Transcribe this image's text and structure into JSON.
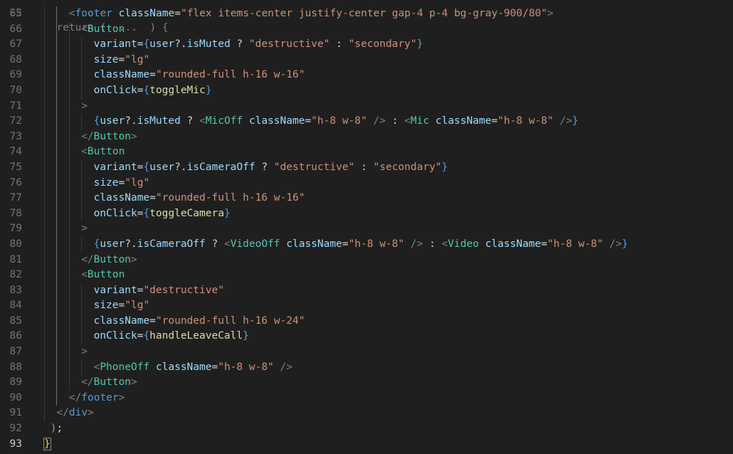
{
  "editor": {
    "top_partial_line": {
      "number": "22",
      "text": "  return (  ...  ) {"
    },
    "current_line": 93,
    "lines": [
      {
        "n": "65",
        "indent": 2,
        "tokens": [
          {
            "c": "t-punc",
            "t": "<"
          },
          {
            "c": "t-html",
            "t": "footer"
          },
          {
            "c": "t-text",
            "t": " "
          },
          {
            "c": "t-attr",
            "t": "className"
          },
          {
            "c": "t-text",
            "t": "="
          },
          {
            "c": "t-str",
            "t": "\"flex items-center justify-center gap-4 p-4 bg-gray-900/80\""
          },
          {
            "c": "t-punc",
            "t": ">"
          }
        ]
      },
      {
        "n": "66",
        "indent": 3,
        "tokens": [
          {
            "c": "t-punc",
            "t": "<"
          },
          {
            "c": "t-tag",
            "t": "Button"
          }
        ]
      },
      {
        "n": "67",
        "indent": 4,
        "tokens": [
          {
            "c": "t-attr",
            "t": "variant"
          },
          {
            "c": "t-text",
            "t": "="
          },
          {
            "c": "t-brace",
            "t": "{"
          },
          {
            "c": "t-attr",
            "t": "user"
          },
          {
            "c": "t-text",
            "t": "?."
          },
          {
            "c": "t-attr",
            "t": "isMuted"
          },
          {
            "c": "t-text",
            "t": " ? "
          },
          {
            "c": "t-str",
            "t": "\"destructive\""
          },
          {
            "c": "t-text",
            "t": " : "
          },
          {
            "c": "t-str",
            "t": "\"secondary\""
          },
          {
            "c": "t-brace",
            "t": "}"
          }
        ]
      },
      {
        "n": "68",
        "indent": 4,
        "tokens": [
          {
            "c": "t-attr",
            "t": "size"
          },
          {
            "c": "t-text",
            "t": "="
          },
          {
            "c": "t-str",
            "t": "\"lg\""
          }
        ]
      },
      {
        "n": "69",
        "indent": 4,
        "tokens": [
          {
            "c": "t-attr",
            "t": "className"
          },
          {
            "c": "t-text",
            "t": "="
          },
          {
            "c": "t-str",
            "t": "\"rounded-full h-16 w-16\""
          }
        ]
      },
      {
        "n": "70",
        "indent": 4,
        "tokens": [
          {
            "c": "t-attr",
            "t": "onClick"
          },
          {
            "c": "t-text",
            "t": "="
          },
          {
            "c": "t-brace",
            "t": "{"
          },
          {
            "c": "t-fn",
            "t": "toggleMic"
          },
          {
            "c": "t-brace",
            "t": "}"
          }
        ]
      },
      {
        "n": "71",
        "indent": 3,
        "tokens": [
          {
            "c": "t-punc",
            "t": ">"
          }
        ]
      },
      {
        "n": "72",
        "indent": 4,
        "tokens": [
          {
            "c": "t-brace",
            "t": "{"
          },
          {
            "c": "t-attr",
            "t": "user"
          },
          {
            "c": "t-text",
            "t": "?."
          },
          {
            "c": "t-attr",
            "t": "isMuted"
          },
          {
            "c": "t-text",
            "t": " ? "
          },
          {
            "c": "t-punc",
            "t": "<"
          },
          {
            "c": "t-tag",
            "t": "MicOff"
          },
          {
            "c": "t-text",
            "t": " "
          },
          {
            "c": "t-attr",
            "t": "className"
          },
          {
            "c": "t-text",
            "t": "="
          },
          {
            "c": "t-str",
            "t": "\"h-8 w-8\""
          },
          {
            "c": "t-text",
            "t": " "
          },
          {
            "c": "t-punc",
            "t": "/>"
          },
          {
            "c": "t-text",
            "t": " : "
          },
          {
            "c": "t-punc",
            "t": "<"
          },
          {
            "c": "t-tag",
            "t": "Mic"
          },
          {
            "c": "t-text",
            "t": " "
          },
          {
            "c": "t-attr",
            "t": "className"
          },
          {
            "c": "t-text",
            "t": "="
          },
          {
            "c": "t-str",
            "t": "\"h-8 w-8\""
          },
          {
            "c": "t-text",
            "t": " "
          },
          {
            "c": "t-punc",
            "t": "/>"
          },
          {
            "c": "t-brace",
            "t": "}"
          }
        ]
      },
      {
        "n": "73",
        "indent": 3,
        "tokens": [
          {
            "c": "t-punc",
            "t": "</"
          },
          {
            "c": "t-tag",
            "t": "Button"
          },
          {
            "c": "t-punc",
            "t": ">"
          }
        ]
      },
      {
        "n": "74",
        "indent": 3,
        "tokens": [
          {
            "c": "t-punc",
            "t": "<"
          },
          {
            "c": "t-tag",
            "t": "Button"
          }
        ]
      },
      {
        "n": "75",
        "indent": 4,
        "tokens": [
          {
            "c": "t-attr",
            "t": "variant"
          },
          {
            "c": "t-text",
            "t": "="
          },
          {
            "c": "t-brace",
            "t": "{"
          },
          {
            "c": "t-attr",
            "t": "user"
          },
          {
            "c": "t-text",
            "t": "?."
          },
          {
            "c": "t-attr",
            "t": "isCameraOff"
          },
          {
            "c": "t-text",
            "t": " ? "
          },
          {
            "c": "t-str",
            "t": "\"destructive\""
          },
          {
            "c": "t-text",
            "t": " : "
          },
          {
            "c": "t-str",
            "t": "\"secondary\""
          },
          {
            "c": "t-brace",
            "t": "}"
          }
        ]
      },
      {
        "n": "76",
        "indent": 4,
        "tokens": [
          {
            "c": "t-attr",
            "t": "size"
          },
          {
            "c": "t-text",
            "t": "="
          },
          {
            "c": "t-str",
            "t": "\"lg\""
          }
        ]
      },
      {
        "n": "77",
        "indent": 4,
        "tokens": [
          {
            "c": "t-attr",
            "t": "className"
          },
          {
            "c": "t-text",
            "t": "="
          },
          {
            "c": "t-str",
            "t": "\"rounded-full h-16 w-16\""
          }
        ]
      },
      {
        "n": "78",
        "indent": 4,
        "tokens": [
          {
            "c": "t-attr",
            "t": "onClick"
          },
          {
            "c": "t-text",
            "t": "="
          },
          {
            "c": "t-brace",
            "t": "{"
          },
          {
            "c": "t-fn",
            "t": "toggleCamera"
          },
          {
            "c": "t-brace",
            "t": "}"
          }
        ]
      },
      {
        "n": "79",
        "indent": 3,
        "tokens": [
          {
            "c": "t-punc",
            "t": ">"
          }
        ]
      },
      {
        "n": "80",
        "indent": 4,
        "tokens": [
          {
            "c": "t-brace",
            "t": "{"
          },
          {
            "c": "t-attr",
            "t": "user"
          },
          {
            "c": "t-text",
            "t": "?."
          },
          {
            "c": "t-attr",
            "t": "isCameraOff"
          },
          {
            "c": "t-text",
            "t": " ? "
          },
          {
            "c": "t-punc",
            "t": "<"
          },
          {
            "c": "t-tag",
            "t": "VideoOff"
          },
          {
            "c": "t-text",
            "t": " "
          },
          {
            "c": "t-attr",
            "t": "className"
          },
          {
            "c": "t-text",
            "t": "="
          },
          {
            "c": "t-str",
            "t": "\"h-8 w-8\""
          },
          {
            "c": "t-text",
            "t": " "
          },
          {
            "c": "t-punc",
            "t": "/>"
          },
          {
            "c": "t-text",
            "t": " : "
          },
          {
            "c": "t-punc",
            "t": "<"
          },
          {
            "c": "t-tag",
            "t": "Video"
          },
          {
            "c": "t-text",
            "t": " "
          },
          {
            "c": "t-attr",
            "t": "className"
          },
          {
            "c": "t-text",
            "t": "="
          },
          {
            "c": "t-str",
            "t": "\"h-8 w-8\""
          },
          {
            "c": "t-text",
            "t": " "
          },
          {
            "c": "t-punc",
            "t": "/>"
          },
          {
            "c": "t-brace",
            "t": "}"
          }
        ]
      },
      {
        "n": "81",
        "indent": 3,
        "tokens": [
          {
            "c": "t-punc",
            "t": "</"
          },
          {
            "c": "t-tag",
            "t": "Button"
          },
          {
            "c": "t-punc",
            "t": ">"
          }
        ]
      },
      {
        "n": "82",
        "indent": 3,
        "tokens": [
          {
            "c": "t-punc",
            "t": "<"
          },
          {
            "c": "t-tag",
            "t": "Button"
          }
        ]
      },
      {
        "n": "83",
        "indent": 4,
        "tokens": [
          {
            "c": "t-attr",
            "t": "variant"
          },
          {
            "c": "t-text",
            "t": "="
          },
          {
            "c": "t-str",
            "t": "\"destructive\""
          }
        ]
      },
      {
        "n": "84",
        "indent": 4,
        "tokens": [
          {
            "c": "t-attr",
            "t": "size"
          },
          {
            "c": "t-text",
            "t": "="
          },
          {
            "c": "t-str",
            "t": "\"lg\""
          }
        ]
      },
      {
        "n": "85",
        "indent": 4,
        "tokens": [
          {
            "c": "t-attr",
            "t": "className"
          },
          {
            "c": "t-text",
            "t": "="
          },
          {
            "c": "t-str",
            "t": "\"rounded-full h-16 w-24\""
          }
        ]
      },
      {
        "n": "86",
        "indent": 4,
        "tokens": [
          {
            "c": "t-attr",
            "t": "onClick"
          },
          {
            "c": "t-text",
            "t": "="
          },
          {
            "c": "t-brace",
            "t": "{"
          },
          {
            "c": "t-fn",
            "t": "handleLeaveCall"
          },
          {
            "c": "t-brace",
            "t": "}"
          }
        ]
      },
      {
        "n": "87",
        "indent": 3,
        "tokens": [
          {
            "c": "t-punc",
            "t": ">"
          }
        ]
      },
      {
        "n": "88",
        "indent": 4,
        "tokens": [
          {
            "c": "t-punc",
            "t": "<"
          },
          {
            "c": "t-tag",
            "t": "PhoneOff"
          },
          {
            "c": "t-text",
            "t": " "
          },
          {
            "c": "t-attr",
            "t": "className"
          },
          {
            "c": "t-text",
            "t": "="
          },
          {
            "c": "t-str",
            "t": "\"h-8 w-8\""
          },
          {
            "c": "t-text",
            "t": " "
          },
          {
            "c": "t-punc",
            "t": "/>"
          }
        ]
      },
      {
        "n": "89",
        "indent": 3,
        "tokens": [
          {
            "c": "t-punc",
            "t": "</"
          },
          {
            "c": "t-tag",
            "t": "Button"
          },
          {
            "c": "t-punc",
            "t": ">"
          }
        ]
      },
      {
        "n": "90",
        "indent": 2,
        "tokens": [
          {
            "c": "t-punc",
            "t": "</"
          },
          {
            "c": "t-html",
            "t": "footer"
          },
          {
            "c": "t-punc",
            "t": ">"
          }
        ]
      },
      {
        "n": "91",
        "indent": 1,
        "tokens": [
          {
            "c": "t-punc",
            "t": "</"
          },
          {
            "c": "t-html",
            "t": "div"
          },
          {
            "c": "t-punc",
            "t": ">"
          }
        ]
      },
      {
        "n": "92",
        "indent": 0.5,
        "tokens": [
          {
            "c": "t-paren",
            "t": ")"
          },
          {
            "c": "t-text",
            "t": ";"
          }
        ]
      },
      {
        "n": "93",
        "indent": 0,
        "tokens": [
          {
            "c": "t-curly bracket-match",
            "t": "}"
          }
        ]
      }
    ]
  }
}
